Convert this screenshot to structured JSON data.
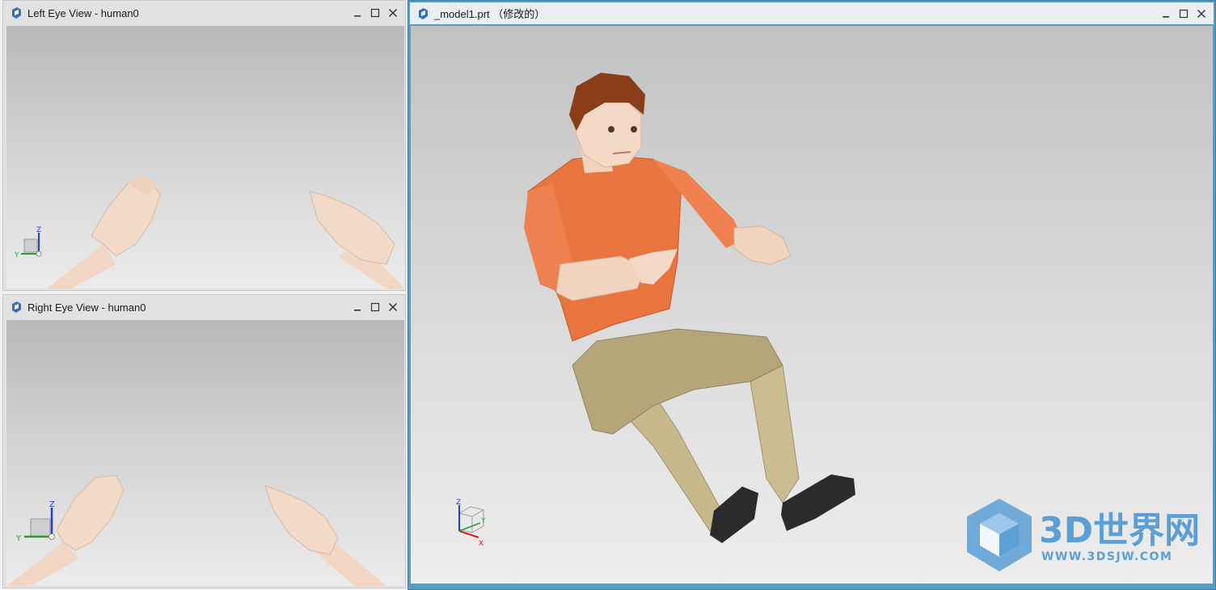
{
  "left_eye_window": {
    "title": "Left Eye View - human0",
    "triad": {
      "z_label": "Z",
      "y_label": "Y"
    }
  },
  "right_eye_window": {
    "title": "Right Eye View - human0",
    "triad": {
      "z_label": "Z",
      "y_label": "Y"
    }
  },
  "main_window": {
    "title": "_model1.prt （修改的）",
    "triad": {
      "z_label": "Z",
      "y_label": "Y",
      "x_label": "X"
    },
    "watermark": {
      "logo_text": "3D世界网",
      "url_text": "WWW.3DSJW.COM"
    }
  },
  "window_controls": [
    "minimize-icon",
    "maximize-icon",
    "close-icon"
  ],
  "colors": {
    "active_frame": "#5a9bbe",
    "shirt": "#e8743f",
    "pants": "#c8b98c",
    "shoes": "#2b2b2b",
    "skin": "#f2d3be",
    "hair": "#8a3d16",
    "axis_z": "#1f3fd0",
    "axis_y": "#2e9a2e",
    "axis_x": "#d02020",
    "watermark": "#5b9fd6"
  }
}
